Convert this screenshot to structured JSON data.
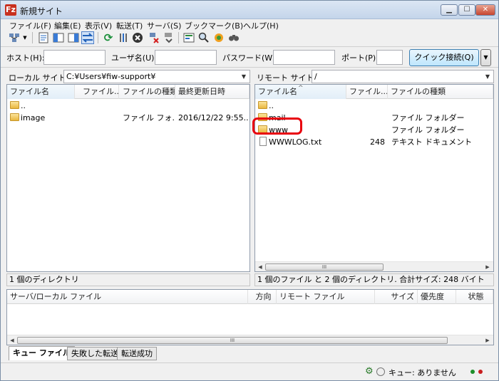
{
  "window": {
    "title": "新規サイト",
    "app_icon": "Fz"
  },
  "menu": [
    "ファイル(F)",
    "編集(E)",
    "表示(V)",
    "転送(T)",
    "サーバ(S)",
    "ブックマーク(B)",
    "ヘルプ(H)"
  ],
  "toolbar_icons": [
    "site-manager-icon",
    "dropdown-icon",
    "message-log-icon",
    "local-tree-icon",
    "remote-tree-icon",
    "transfer-queue-icon",
    "refresh-icon",
    "process-queue-icon",
    "cancel-icon",
    "disconnect-icon",
    "reconnect-icon",
    "filter-icon",
    "dir-compare-icon",
    "sync-browse-icon",
    "search-icon"
  ],
  "quickconnect": {
    "host_label": "ホスト(H):",
    "user_label": "ユーザ名(U):",
    "pass_label": "パスワード(W):",
    "port_label": "ポート(P):",
    "host_value": "",
    "user_value": "",
    "pass_value": "",
    "port_value": "",
    "connect_button": "クイック接続(Q)",
    "dropdown": "▼"
  },
  "local": {
    "site_label": "ローカル サイト:",
    "path": "C:¥Users¥fiw-support¥",
    "columns": [
      "ファイル名",
      "ファイル...",
      "ファイルの種類",
      "最終更新日時"
    ],
    "rows": [
      {
        "name": "..",
        "size": "",
        "type": "",
        "modified": ""
      },
      {
        "name": "image",
        "size": "",
        "type": "ファイル フォ...",
        "modified": "2016/12/22 9:55..."
      }
    ],
    "status": "1 個のディレクトリ"
  },
  "remote": {
    "site_label": "リモート サイト:",
    "path": "/",
    "columns": [
      "ファイル名",
      "ファイル...",
      "ファイルの種類"
    ],
    "sort_indicator": "^",
    "rows": [
      {
        "name": "..",
        "size": "",
        "type": ""
      },
      {
        "name": "mail",
        "size": "",
        "type": "ファイル フォルダー"
      },
      {
        "name": "www",
        "size": "",
        "type": "ファイル フォルダー"
      },
      {
        "name": "WWWLOG.txt",
        "size": "248",
        "type": "テキスト ドキュメント"
      }
    ],
    "scroll_grip": "III",
    "status": "1 個のファイル と 2 個のディレクトリ. 合計サイズ: 248 バイト"
  },
  "queue": {
    "columns": [
      "サーバ/ローカル ファイル",
      "方向",
      "リモート ファイル",
      "サイズ",
      "優先度",
      "状態"
    ],
    "scroll_grip": "III",
    "tabs": [
      "キュー ファイル",
      "失敗した転送",
      "転送成功"
    ]
  },
  "statusbar": {
    "queue_text": "キュー: ありません"
  },
  "colors": {
    "highlight": "#e8000d",
    "led_green": "#1e8f2a",
    "led_red": "#c81e1e"
  }
}
